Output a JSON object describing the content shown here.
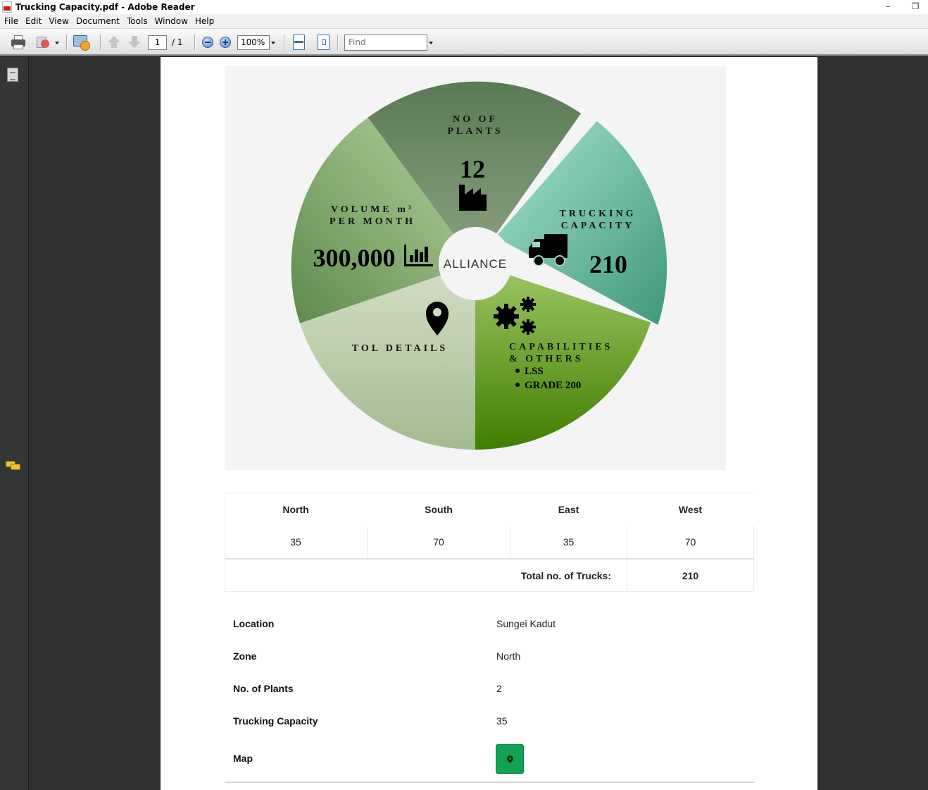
{
  "window": {
    "title": "Trucking Capacity.pdf - Adobe Reader",
    "minimize": "–",
    "restore": "❐"
  },
  "menu": [
    "File",
    "Edit",
    "View",
    "Document",
    "Tools",
    "Window",
    "Help"
  ],
  "toolbar": {
    "current_page": "1",
    "page_total": "/ 1",
    "zoom": "100%",
    "find_placeholder": "Find"
  },
  "infographic": {
    "center": "ALLIANCE",
    "plants": {
      "title_line1": "NO OF",
      "title_line2": "PLANTS",
      "value": "12"
    },
    "trucking": {
      "title_line1": "TRUCKING",
      "title_line2": "CAPACITY",
      "value": "210"
    },
    "volume": {
      "title_line1": "VOLUME m³",
      "title_line2": "PER MONTH",
      "value": "300,000"
    },
    "tol": {
      "title": "TOL DETAILS"
    },
    "capabilities": {
      "title_line1": "CAPABILITIES",
      "title_line2": "& OTHERS",
      "items": [
        "LSS",
        "GRADE 200"
      ]
    }
  },
  "trucks_table": {
    "headers": [
      "North",
      "South",
      "East",
      "West"
    ],
    "values": [
      "35",
      "70",
      "35",
      "70"
    ],
    "total_label": "Total no. of Trucks:",
    "total_value": "210"
  },
  "details": {
    "rows": [
      {
        "label": "Location",
        "value": "Sungei Kadut"
      },
      {
        "label": "Zone",
        "value": "North"
      },
      {
        "label": "No. of Plants",
        "value": "2"
      },
      {
        "label": "Trucking Capacity",
        "value": "35"
      }
    ],
    "map_label": "Map"
  },
  "colors": {
    "map_button": "#13a153",
    "dark_green": "#4f7f2a"
  }
}
